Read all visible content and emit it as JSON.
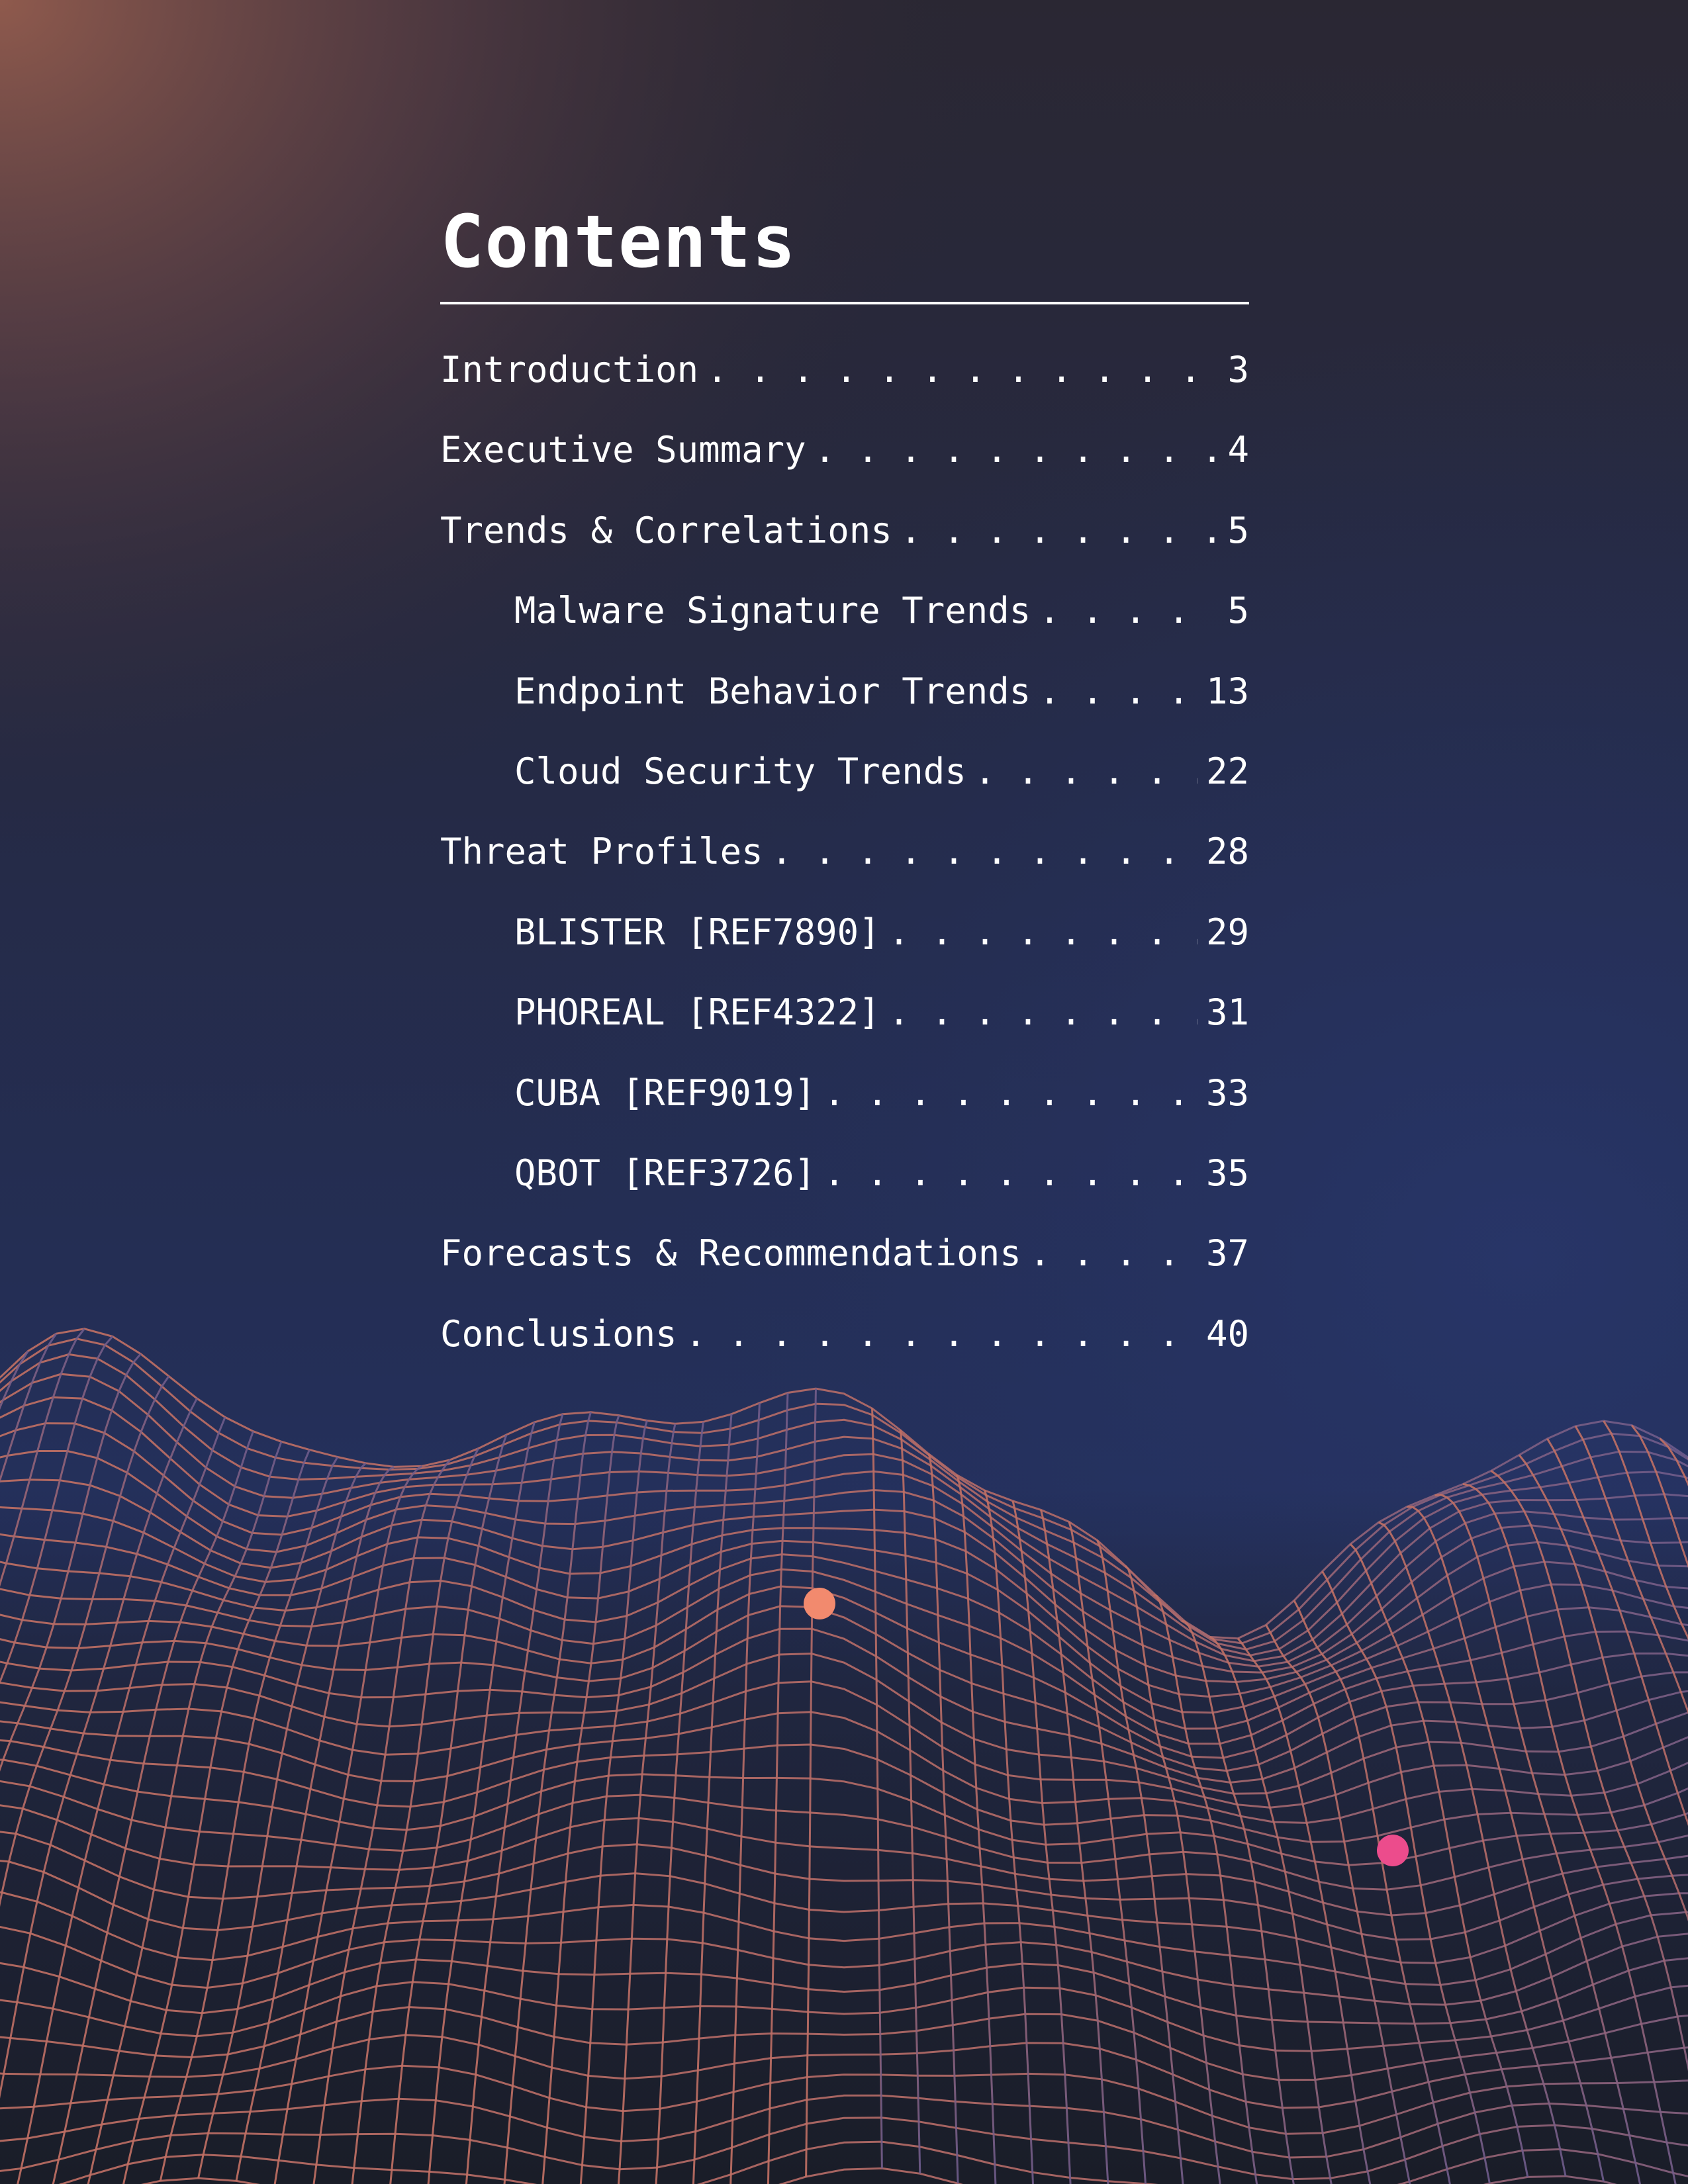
{
  "title": "Contents",
  "entries": [
    {
      "label": "Introduction",
      "page": "3",
      "level": 1
    },
    {
      "label": "Executive Summary",
      "page": "4",
      "level": 1
    },
    {
      "label": "Trends & Correlations",
      "page": "5",
      "level": 1
    },
    {
      "label": "Malware Signature Trends",
      "page": "5",
      "level": 2
    },
    {
      "label": "Endpoint Behavior Trends",
      "page": "13",
      "level": 2
    },
    {
      "label": "Cloud Security Trends",
      "page": "22",
      "level": 2
    },
    {
      "label": "Threat Profiles",
      "page": "28",
      "level": 1
    },
    {
      "label": "BLISTER [REF7890]",
      "page": "29",
      "level": 2
    },
    {
      "label": "PHOREAL [REF4322]",
      "page": "31",
      "level": 2
    },
    {
      "label": "CUBA [REF9019]",
      "page": "33",
      "level": 2
    },
    {
      "label": "QBOT [REF3726]",
      "page": "35",
      "level": 2
    },
    {
      "label": "Forecasts & Recommendations",
      "page": "37",
      "level": 1
    },
    {
      "label": "Conclusions",
      "page": "40",
      "level": 1
    }
  ],
  "colors": {
    "background_top_left": "#8a574c",
    "background_navy": "#24305c",
    "background_dark": "#1c2030",
    "wireframe": "#c27063",
    "dot_peach": "#f28a6e",
    "dot_pink": "#ec4c8c",
    "text": "#ffffff"
  }
}
